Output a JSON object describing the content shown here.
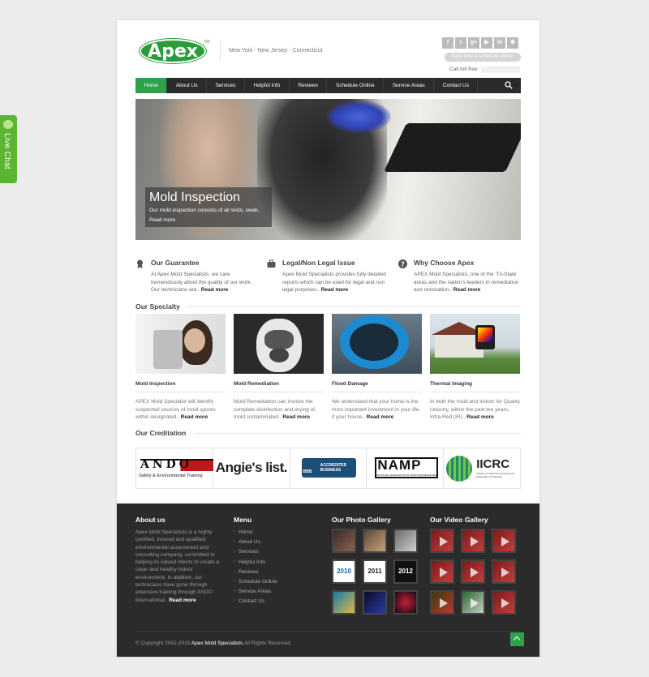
{
  "live_chat": {
    "label": "Live Chat"
  },
  "header": {
    "logo": "Apex",
    "trademark": "TM",
    "tagline": "New York - New Jersey - Connecticut",
    "socials": [
      {
        "icon": "facebook-icon",
        "glyph": "f"
      },
      {
        "icon": "twitter-icon",
        "glyph": "t"
      },
      {
        "icon": "google-plus-icon",
        "glyph": "g+"
      },
      {
        "icon": "youtube-icon",
        "glyph": "▶"
      },
      {
        "icon": "linkedin-icon",
        "glyph": "in"
      },
      {
        "icon": "yelp-icon",
        "glyph": "✱"
      }
    ],
    "save_time": "Save time & schedule online!",
    "toll_free": "Call toll free:"
  },
  "nav": {
    "items": [
      "Home",
      "About Us",
      "Services",
      "Helpful Info",
      "Reviews",
      "Schedule Online",
      "Service Areas",
      "Contact Us"
    ],
    "active": "Home"
  },
  "hero": {
    "title": "Mold Inspection",
    "text": "Our mold inspection consists of air tests, swab..",
    "link": "Read more"
  },
  "features": [
    {
      "title": "Our Guarantee",
      "icon": "medal-icon",
      "text": "At Apex Mold Specialists, we care tremendously about the quality of our work. Our technicians are..",
      "link": "Read more"
    },
    {
      "title": "Legal/Non Legal Issue",
      "icon": "briefcase-icon",
      "text": "Apex Mold Specialists provides fully detailed reports which can be used for legal and non legal purposes..",
      "link": "Read more"
    },
    {
      "title": "Why Choose Apex",
      "icon": "question-icon",
      "text": "APEX Mold Specialists, one of the 'Tri-State' areas and the nation's leaders in remediation and restoration..",
      "link": "Read more"
    }
  ],
  "specialty": {
    "title": "Our Specialty",
    "items": [
      {
        "title": "Mold Inspection",
        "text": "APEX Mold Specialist will identify suspected sources of mold spores within designated..",
        "link": "Read more"
      },
      {
        "title": "Mold Remediation",
        "text": "Mold Remediation can involve the complete disinfection and drying of mold contaminated..",
        "link": "Read more"
      },
      {
        "title": "Flood Damage",
        "text": "We understand that your home is the most important investment in your life, if your house..",
        "link": "Read more"
      },
      {
        "title": "Thermal Imaging",
        "text": "In both the mold and Indoor Air Quality industry, within the past ten years, Infra-Red (IR)..",
        "link": "Read more"
      }
    ]
  },
  "creditation": {
    "title": "Our Creditation",
    "logos": [
      {
        "name": "ANDO",
        "sub": "Safety & Environmental Training"
      },
      {
        "name": "Angie's list."
      },
      {
        "name": "BBB",
        "sub": "ACCREDITED BUSINESS"
      },
      {
        "name": "NAMP",
        "sub": "NATIONAL ASSOCIATION OF MOLD PROFESSIONALS"
      },
      {
        "name": "IICRC",
        "sub": "Institute of Inspection Cleaning and Restoration Certification"
      }
    ]
  },
  "footer": {
    "about_title": "About us",
    "about_text": "Apex Mold Specialists is a highly certified, insured and qualified environmental assessment and consulting company, committed to helping its valued clients to create a clean and healthy indoor environment. In addition, our technicians have gone through extensive training through ANDO International..",
    "about_link": "Read more",
    "menu_title": "Menu",
    "menu": [
      "Home",
      "About Us",
      "Services",
      "Helpful Info",
      "Reviews",
      "Schedule Online",
      "Service Areas",
      "Contact Us"
    ],
    "photo_title": "Our Photo Gallery",
    "photo_labels": [
      "",
      "",
      "",
      "2010",
      "2011",
      "2012",
      "",
      "",
      ""
    ],
    "video_title": "Our Video Gallery",
    "copyright_prefix": "© Copyright 2002-2015",
    "copyright_name": "Apex Mold Specialists",
    "copyright_suffix": "All Rights Reserved."
  },
  "colors": {
    "accent": "#2ea14a",
    "nav": "#2b2b2b",
    "footer": "#2b2b2b"
  }
}
